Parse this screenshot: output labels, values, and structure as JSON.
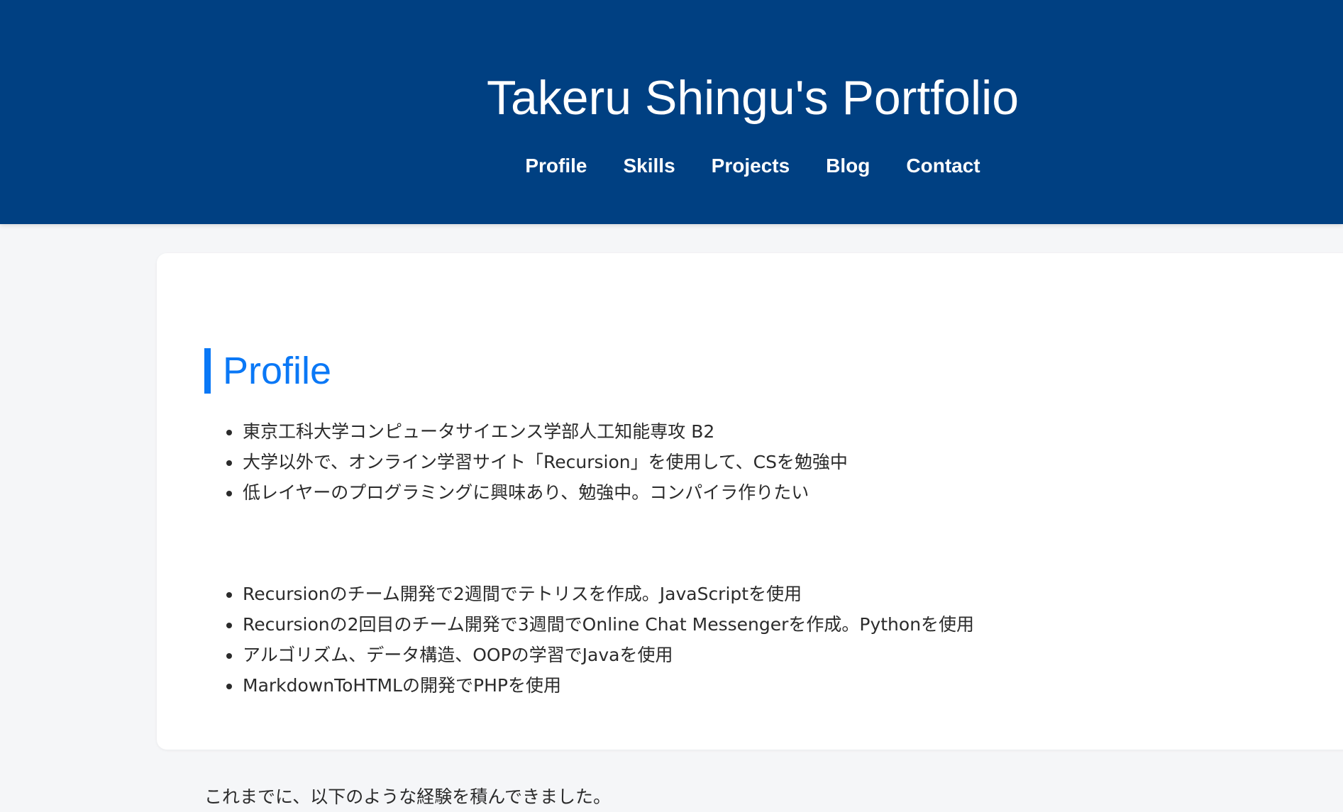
{
  "header": {
    "title": "Takeru Shingu's Portfolio",
    "nav": [
      {
        "label": "Profile"
      },
      {
        "label": "Skills"
      },
      {
        "label": "Projects"
      },
      {
        "label": "Blog"
      },
      {
        "label": "Contact"
      }
    ],
    "background_color": "#004082"
  },
  "profile": {
    "heading": "Profile",
    "accent_color": "#0a78f6",
    "items": [
      "東京工科大学コンピュータサイエンス学部人工知能専攻 B2",
      "大学以外で、オンライン学習サイト「Recursion」を使用して、CSを勉強中",
      "低レイヤーのプログラミングに興味あり、勉強中。コンパイラ作りたい"
    ],
    "intro": "これまでに、以下のような経験を積んできました。",
    "experience": [
      "Recursionのチーム開発で2週間でテトリスを作成。JavaScriptを使用",
      "Recursionの2回目のチーム開発で3週間でOnline Chat Messengerを作成。Pythonを使用",
      "アルゴリズム、データ構造、OOPの学習でJavaを使用",
      "MarkdownToHTMLの開発でPHPを使用"
    ]
  }
}
